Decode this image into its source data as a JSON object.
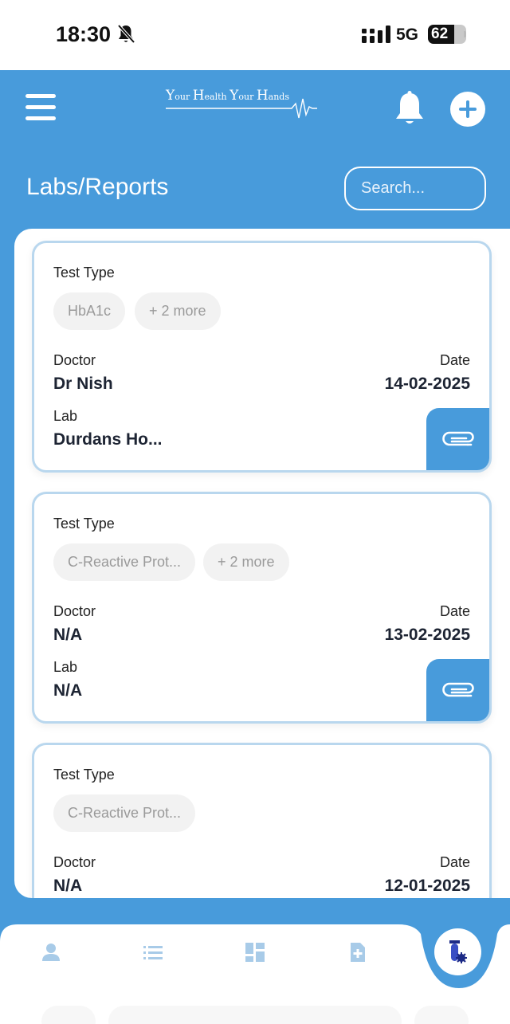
{
  "status_bar": {
    "time": "18:30",
    "network": "5G",
    "battery": "62"
  },
  "header": {
    "logo_text": "Your Health Your Hands",
    "page_title": "Labs/Reports",
    "search_placeholder": "Search..."
  },
  "cards": [
    {
      "test_type_label": "Test Type",
      "chips": [
        "HbA1c",
        "+ 2 more"
      ],
      "doctor_label": "Doctor",
      "doctor": "Dr Nish",
      "date_label": "Date",
      "date": "14-02-2025",
      "lab_label": "Lab",
      "lab": "Durdans Ho..."
    },
    {
      "test_type_label": "Test Type",
      "chips": [
        "C-Reactive Prot...",
        "+ 2 more"
      ],
      "doctor_label": "Doctor",
      "doctor": "N/A",
      "date_label": "Date",
      "date": "13-02-2025",
      "lab_label": "Lab",
      "lab": "N/A"
    },
    {
      "test_type_label": "Test Type",
      "chips": [
        "C-Reactive Prot..."
      ],
      "doctor_label": "Doctor",
      "doctor": "N/A",
      "date_label": "Date",
      "date": "12-01-2025"
    }
  ],
  "bottom_nav": {
    "items": [
      "profile-icon",
      "list-icon",
      "dashboard-icon",
      "add-record-icon",
      "lab-test-icon"
    ],
    "active": "lab-test-icon"
  },
  "colors": {
    "primary": "#489bdb",
    "card_border": "#b9d7ee",
    "chip_bg": "#f2f2f2",
    "nav_icon": "#a8cbe8"
  }
}
